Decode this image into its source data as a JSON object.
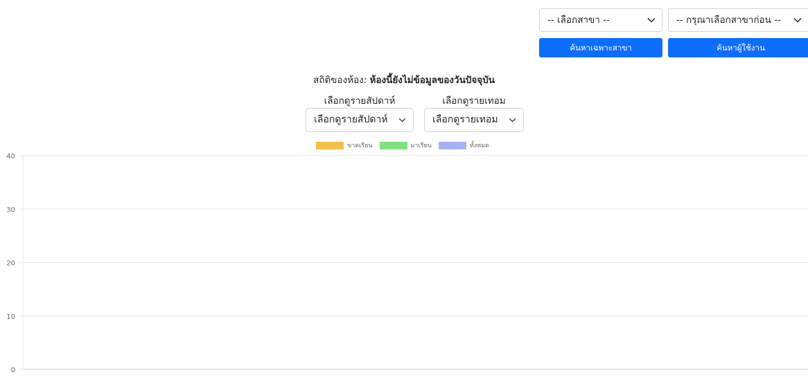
{
  "top_controls": {
    "branch_select": {
      "selected": "-- เลือกสาขา --"
    },
    "user_select": {
      "selected": "-- กรุณาเลือกสาขาก่อน --"
    },
    "search_branch_button": "ค้นหาเฉพาะสาขา",
    "search_user_button": "ค้นหาผู้ใช้งาน"
  },
  "room_stats": {
    "label": "สถิติของห้อง:",
    "value": "ห้องนี้ยังไม่ข้อมูลของวันปัจจุบัน"
  },
  "filters": {
    "weekly": {
      "label": "เลือกดูรายสัปดาห์",
      "selected": "เลือกดูรายสัปดาห์"
    },
    "term": {
      "label": "เลือกดูรายเทอม",
      "selected": "เลือกดูรายเทอม"
    }
  },
  "icons": {
    "dropdown": "chevron-down-icon"
  },
  "chart_data": {
    "type": "bar",
    "title": "",
    "xlabel": "",
    "ylabel": "",
    "categories": [],
    "series": [
      {
        "name": "ขาดเรียน",
        "color": "#f5be4b",
        "values": []
      },
      {
        "name": "มาเรียน",
        "color": "#80e080",
        "values": []
      },
      {
        "name": "ทั้งหมด",
        "color": "#a8b0f5",
        "values": []
      }
    ],
    "ylim": [
      0,
      40
    ],
    "yticks": [
      0,
      10,
      20,
      30,
      40
    ],
    "grid": true,
    "legend": "top-center"
  }
}
